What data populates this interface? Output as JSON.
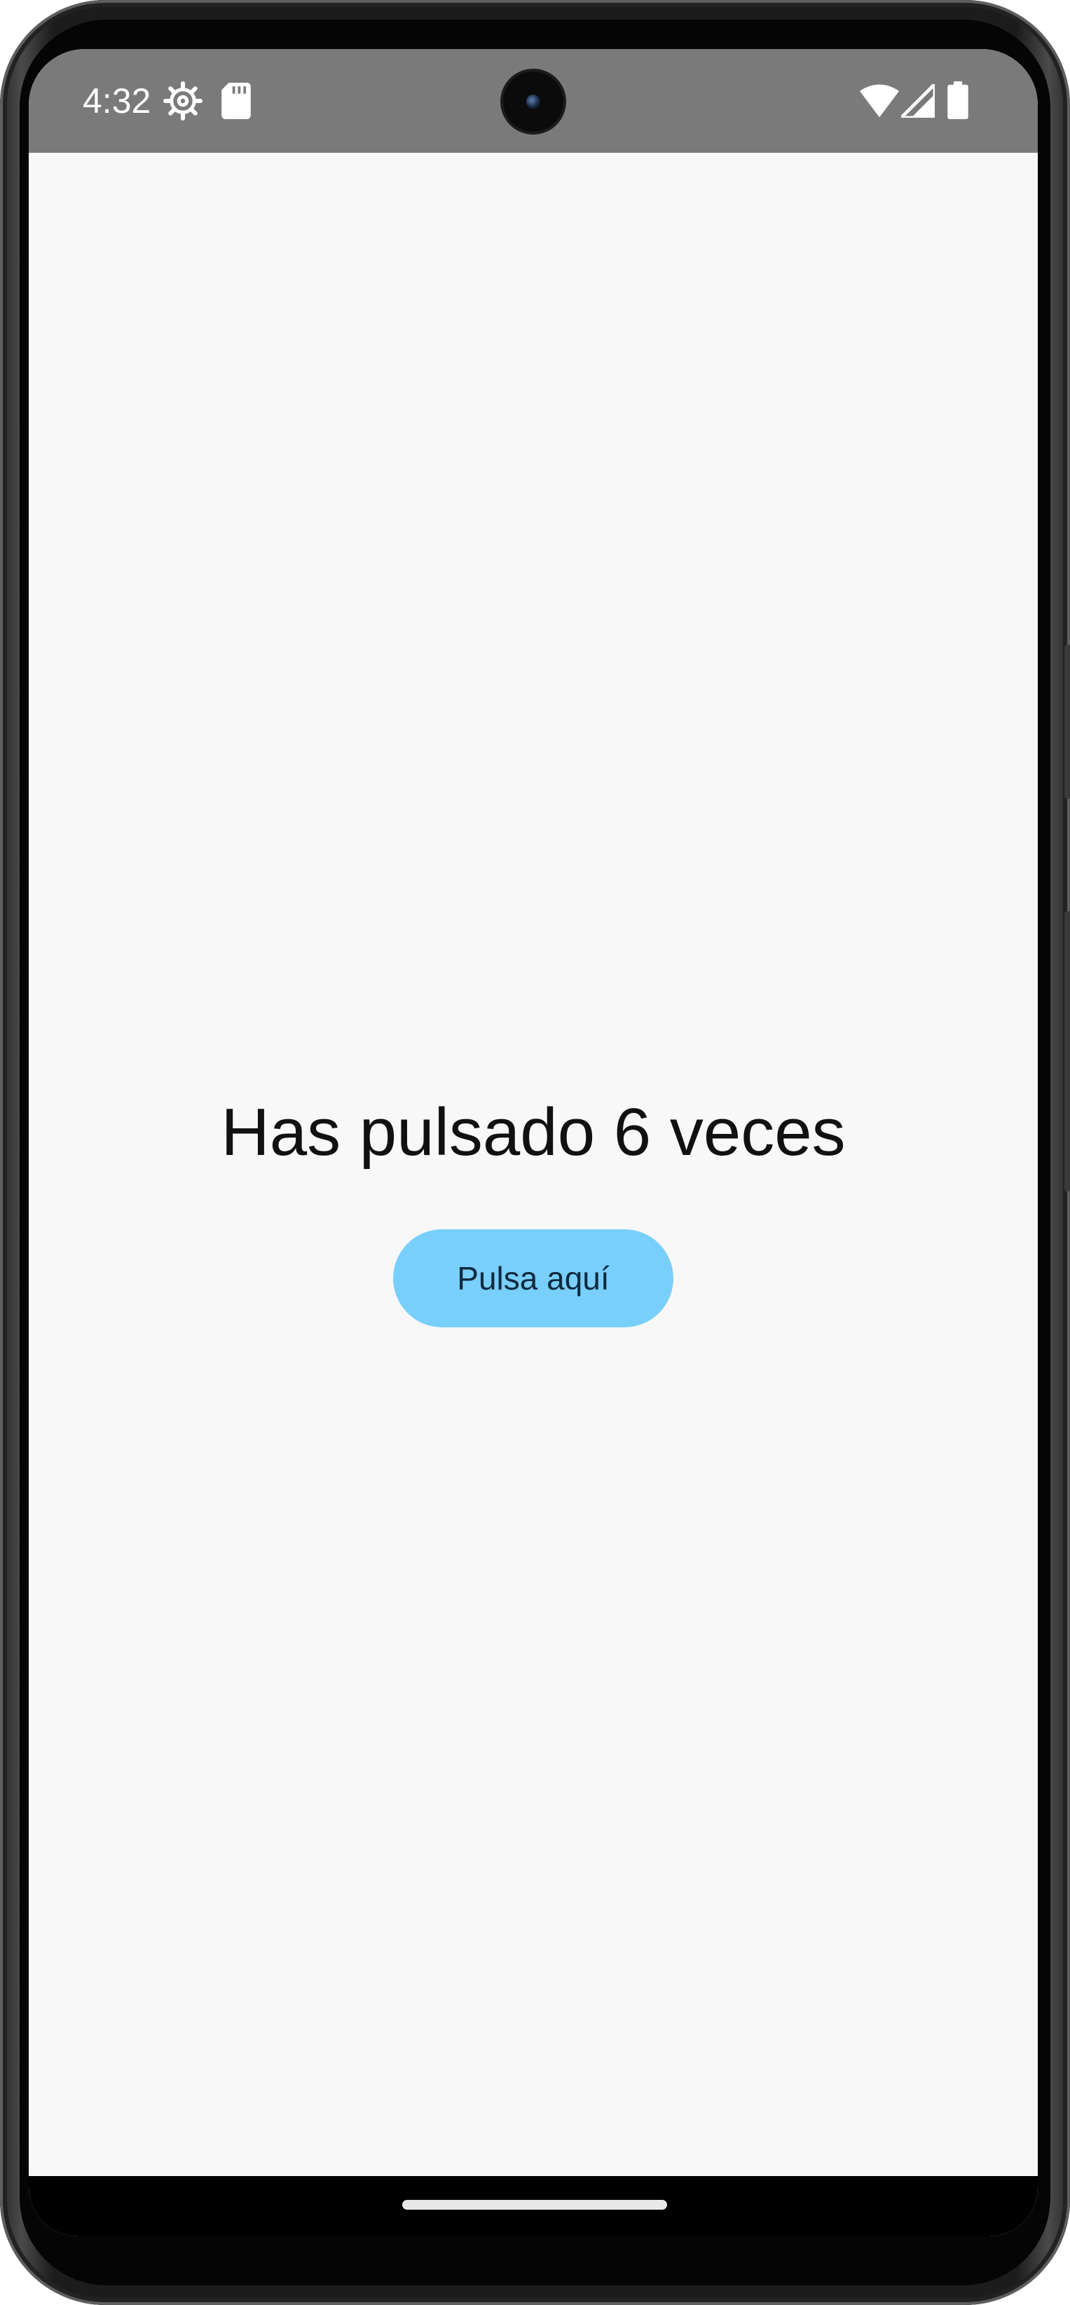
{
  "status_bar": {
    "time": "4:32",
    "left_icons": [
      "settings-gear-icon",
      "sd-card-icon"
    ],
    "right_icons": [
      "wifi-icon",
      "cell-signal-icon",
      "battery-icon"
    ],
    "background_color": "#7a7a7a"
  },
  "main": {
    "counter_text": "Has pulsado 6 veces",
    "button_label": "Pulsa aquí",
    "button_color": "#79cffb"
  }
}
